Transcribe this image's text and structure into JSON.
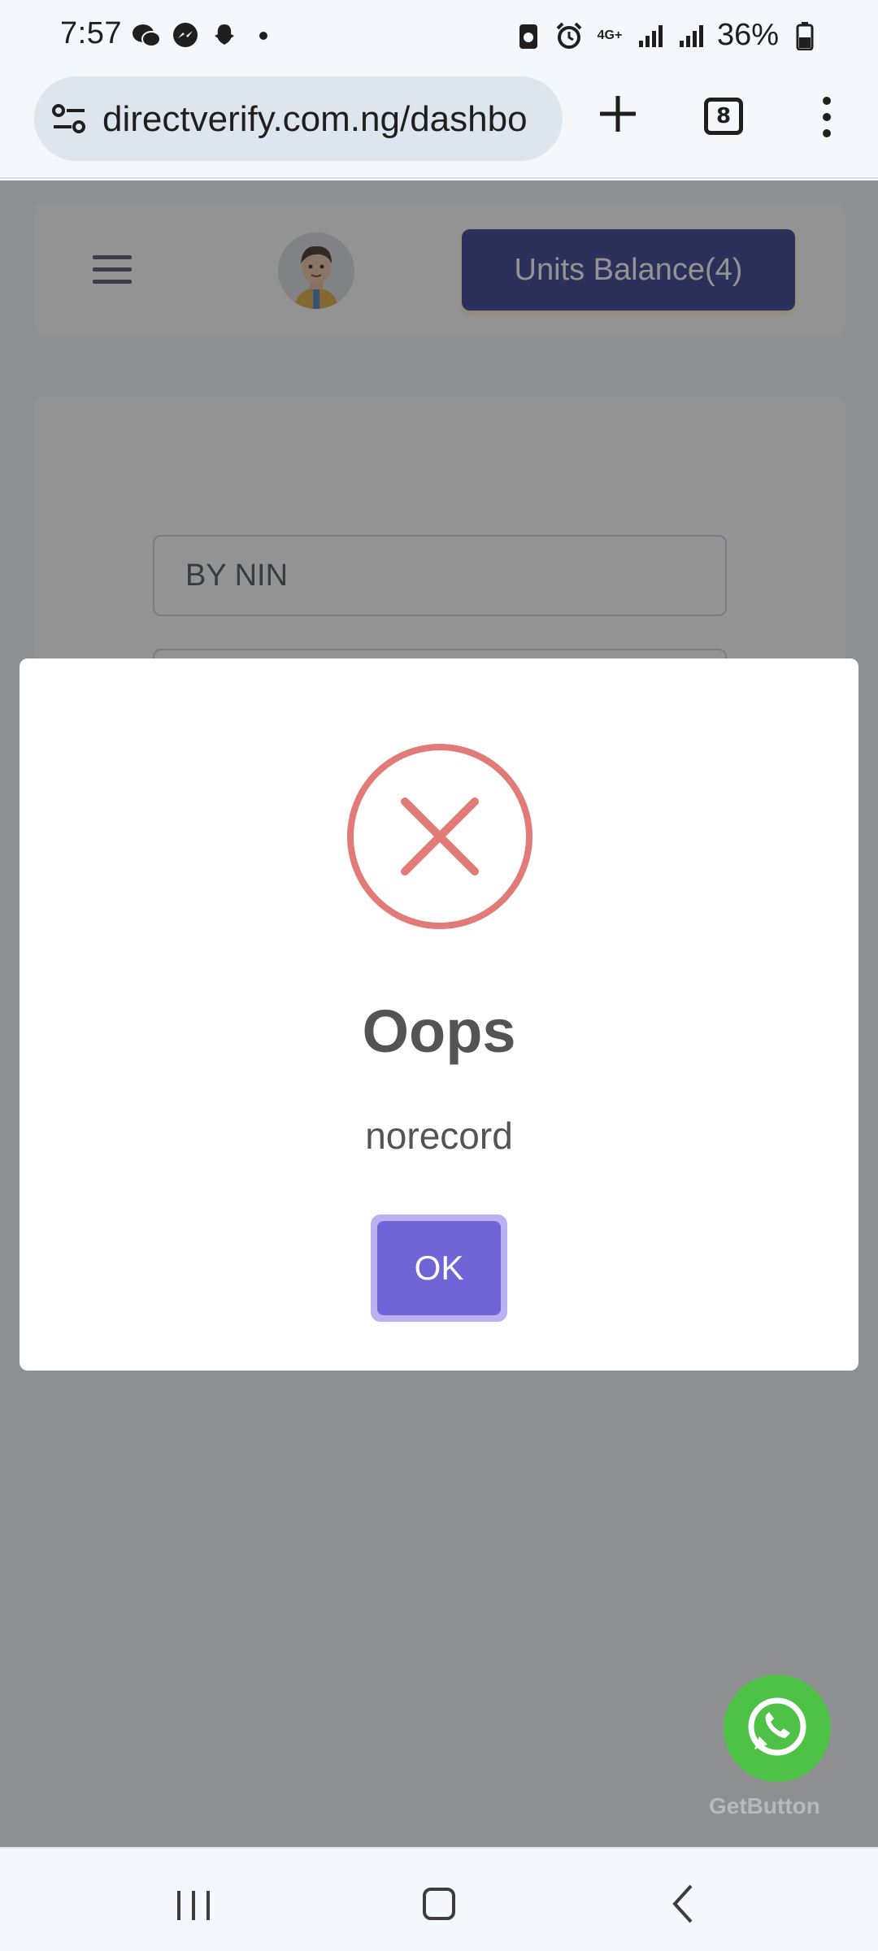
{
  "status_bar": {
    "time": "7:57",
    "battery": "36%",
    "network": "4G+"
  },
  "browser": {
    "url": "directverify.com.ng/dashbo",
    "tab_count": "8"
  },
  "header": {
    "units_balance_label": "Units Balance(4)"
  },
  "form": {
    "search_type": "BY NIN"
  },
  "dialog": {
    "title": "Oops",
    "message": "norecord",
    "ok_label": "OK"
  },
  "floating": {
    "whatsapp_label": "GetButton"
  },
  "colors": {
    "units_button": "#2e3a8c",
    "ok_button": "#7065d6",
    "error_icon": "#e27a77",
    "whatsapp": "#4dc247"
  }
}
